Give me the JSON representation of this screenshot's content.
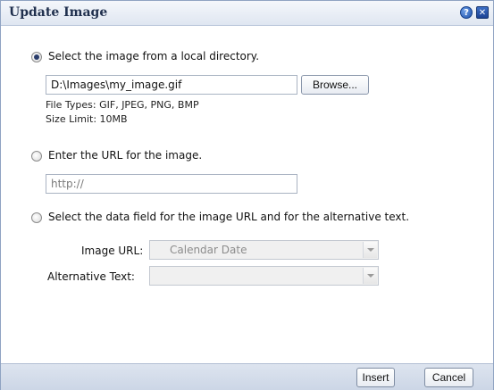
{
  "dialog": {
    "title": "Update Image",
    "help_symbol": "?",
    "close_symbol": "✕"
  },
  "option_local": {
    "label": "Select the image from a local directory.",
    "selected": true,
    "file_path": "D:\\Images\\my_image.gif",
    "browse_label": "Browse...",
    "file_types": "File Types: GIF, JPEG, PNG, BMP",
    "size_limit": "Size Limit: 10MB"
  },
  "option_url": {
    "label": "Enter the URL for the image.",
    "selected": false,
    "url_placeholder": "http://"
  },
  "option_datafield": {
    "label": "Select the data field for the image URL and for the alternative text.",
    "selected": false,
    "image_url_label": "Image URL:",
    "image_url_value": "Calendar Date",
    "alt_text_label": "Alternative Text:",
    "alt_text_value": ""
  },
  "footer": {
    "insert_label": "Insert",
    "cancel_label": "Cancel"
  }
}
